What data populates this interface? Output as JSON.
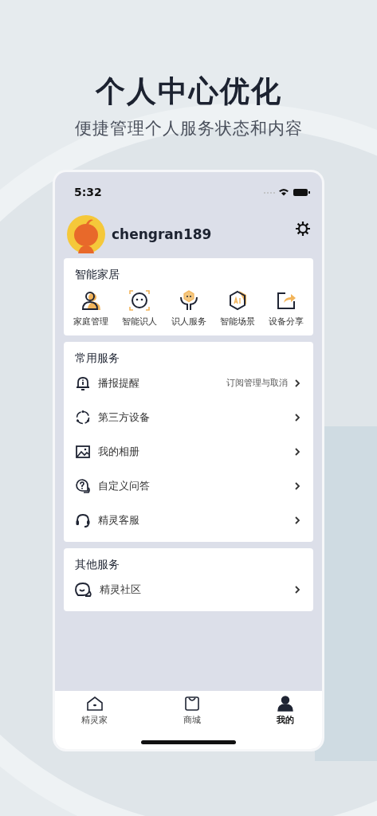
{
  "headline": "个人中心优化",
  "subtitle": "便捷管理个人服务状态和内容",
  "status_bar": {
    "time": "5:32"
  },
  "profile": {
    "username": "chengran189"
  },
  "sections": [
    {
      "kind": "grid",
      "title": "智能家居",
      "items": [
        {
          "label": "家庭管理"
        },
        {
          "label": "智能识人"
        },
        {
          "label": "识人服务"
        },
        {
          "label": "智能场景"
        },
        {
          "label": "设备分享"
        }
      ]
    },
    {
      "kind": "list",
      "title": "常用服务",
      "items": [
        {
          "label": "播报提醒",
          "detail": "订阅管理与取消"
        },
        {
          "label": "第三方设备"
        },
        {
          "label": "我的相册"
        },
        {
          "label": "自定义问答"
        },
        {
          "label": "精灵客服"
        }
      ]
    },
    {
      "kind": "list",
      "title": "其他服务",
      "items": [
        {
          "label": "精灵社区"
        }
      ]
    }
  ],
  "tab_bar": [
    {
      "label": "精灵家",
      "selected": false
    },
    {
      "label": "商城",
      "selected": false
    },
    {
      "label": "我的",
      "selected": true
    }
  ]
}
